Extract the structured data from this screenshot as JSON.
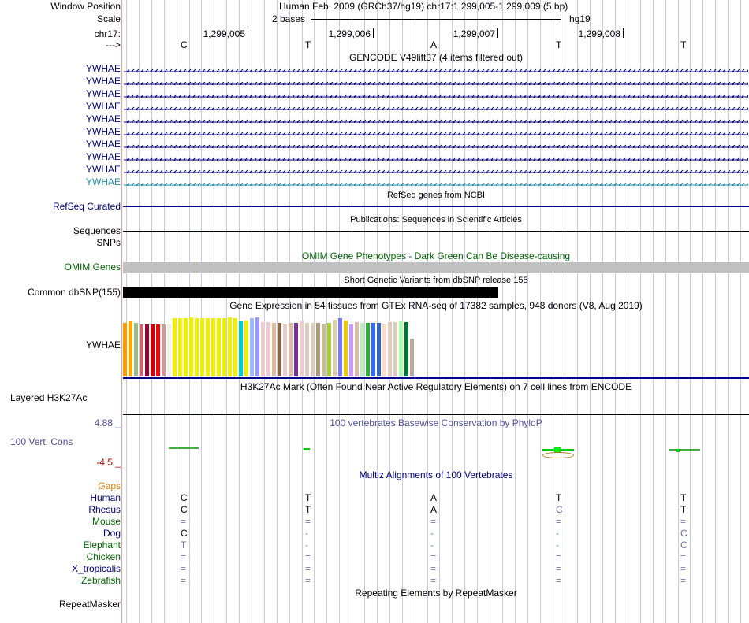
{
  "colors": {
    "navy": "#000080",
    "link": "#0000b0",
    "green": "#006400",
    "orange": "#e08000",
    "cons": "#4f4fa0",
    "red": "#b00000",
    "teal": "#1a8ca8",
    "gray": "#c0c0c0"
  },
  "header": {
    "window_position_label": "Window Position",
    "window_position_value": "Human Feb. 2009 (GRCh37/hg19)   chr17:1,299,005-1,299,009 (5 bp)",
    "scale_label": "Scale",
    "scale_text": "2 bases",
    "scale_assembly": "hg19",
    "chrom_label": "chr17:",
    "positions": [
      "1,299,005",
      "1,299,006",
      "1,299,007",
      "1,299,008"
    ],
    "strand_label": "--->",
    "bases": [
      "C",
      "T",
      "A",
      "T",
      "T"
    ]
  },
  "gencode": {
    "title": "GENCODE V49lift37 (4 items filtered out)",
    "genes": [
      "YWHAE",
      "YWHAE",
      "YWHAE",
      "YWHAE",
      "YWHAE",
      "YWHAE",
      "YWHAE",
      "YWHAE",
      "YWHAE",
      "YWHAE"
    ]
  },
  "refseq": {
    "title": "RefSeq genes from NCBI",
    "label": "RefSeq Curated"
  },
  "pubs": {
    "title": "Publications: Sequences in Scientific Articles",
    "label1": "Sequences",
    "label2": "SNPs"
  },
  "omim": {
    "title": "OMIM Gene Phenotypes - Dark Green Can Be Disease-causing",
    "label": "OMIM Genes"
  },
  "dbsnp": {
    "title": "Short Genetic Variants from dbSNP release 155",
    "label": "Common dbSNP(155)"
  },
  "gtex": {
    "title": "Gene Expression in 54 tissues from GTEx RNA-seq of 17382 samples, 948 donors (V8, Aug 2019)",
    "label": "YWHAE",
    "levels": [
      0.9,
      0.93,
      0.9,
      0.88,
      0.88,
      0.88,
      0.88,
      0.88,
      0.88,
      0.99,
      0.99,
      0.98,
      1.0,
      0.98,
      0.98,
      0.98,
      0.99,
      0.98,
      0.98,
      1.0,
      0.98,
      0.93,
      0.95,
      0.99,
      1.0,
      0.92,
      0.92,
      0.9,
      0.9,
      0.88,
      0.9,
      0.9,
      0.94,
      0.9,
      0.9,
      0.9,
      0.88,
      0.9,
      0.96,
      0.99,
      0.94,
      0.88,
      0.92,
      0.9,
      0.9,
      0.9,
      0.9,
      0.88,
      0.92,
      0.92,
      0.93,
      0.92,
      0.64
    ],
    "tissue_colors": [
      "#ff9900",
      "#ffaa00",
      "#99bb88",
      "#cc6666",
      "#990033",
      "#cc0000",
      "#ff0000",
      "#cc9999",
      "#eeeeee",
      "#eeee00",
      "#eeee00",
      "#eeee00",
      "#eeee00",
      "#eeee00",
      "#eeee00",
      "#eeee00",
      "#eeee00",
      "#eeee00",
      "#eeee00",
      "#eeee00",
      "#eeee00",
      "#00cccc",
      "#eeee00",
      "#99bbff",
      "#9999ff",
      "#eecccc",
      "#eecccc",
      "#ddbb99",
      "#886644",
      "#eecccc",
      "#ddbbaa",
      "#773399",
      "#eecccc",
      "#ddccbb",
      "#ddccbb",
      "#aa9977",
      "#ccbb99",
      "#aacc33",
      "#ddccaa",
      "#7777ff",
      "#eecc00",
      "#cc99ff",
      "#ddbbaa",
      "#bbeebb",
      "#33aa33",
      "#3366ff",
      "#3366cc",
      "#ffddcc",
      "#ddccbb",
      "#ddccbb",
      "#aaffaa",
      "#007733",
      "#bbaa99",
      "#ff00ff"
    ]
  },
  "h3k27ac": {
    "title": "H3K27Ac Mark (Often Found Near Active Regulatory Elements) on 7 cell lines from ENCODE",
    "label": "Layered H3K27Ac"
  },
  "cons": {
    "title": "100 vertebrates Basewise Conservation by PhyloP",
    "label": "100 Vert. Cons",
    "ymax": "4.88 _",
    "ymin": "-4.5 _",
    "scores": [
      0.3,
      0.3,
      -0.1,
      4.0,
      0.6
    ]
  },
  "multiz": {
    "title": "Multiz Alignments of 100 Vertebrates",
    "gaps_label": "Gaps",
    "species": [
      {
        "name": "Human",
        "bases": [
          "C",
          "T",
          "A",
          "T",
          "T"
        ]
      },
      {
        "name": "Rhesus",
        "bases": [
          "C",
          "T",
          "A",
          "C",
          "T"
        ]
      },
      {
        "name": "Mouse",
        "bases": [
          "=",
          "=",
          "=",
          "=",
          "="
        ]
      },
      {
        "name": "Dog",
        "bases": [
          "C",
          "-",
          "-",
          "-",
          "C"
        ]
      },
      {
        "name": "Elephant",
        "bases": [
          "T",
          "-",
          "-",
          "-",
          "C"
        ]
      },
      {
        "name": "Chicken",
        "bases": [
          "=",
          "=",
          "=",
          "=",
          "="
        ]
      },
      {
        "name": "X_tropicalis",
        "bases": [
          "=",
          "=",
          "=",
          "=",
          "="
        ]
      },
      {
        "name": "Zebrafish",
        "bases": [
          "=",
          "=",
          "=",
          "=",
          "="
        ]
      }
    ]
  },
  "repeatmasker": {
    "title": "Repeating Elements by RepeatMasker",
    "label": "RepeatMasker"
  }
}
